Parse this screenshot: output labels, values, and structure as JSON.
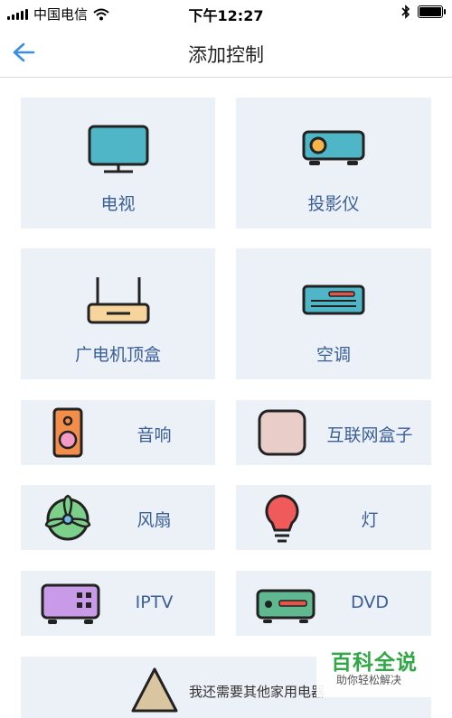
{
  "status_bar": {
    "carrier": "中国电信",
    "time": "下午12:27"
  },
  "header": {
    "title": "添加控制"
  },
  "devices": {
    "tv": "电视",
    "projector": "投影仪",
    "stb": "广电机顶盒",
    "ac": "空调",
    "speaker": "音响",
    "internet_box": "互联网盒子",
    "fan": "风扇",
    "light": "灯",
    "iptv": "IPTV",
    "dvd": "DVD",
    "other": "我还需要其他家用电器"
  },
  "watermark": {
    "main": "百科全说",
    "sub": "助你轻松解决"
  },
  "colors": {
    "card_bg": "#ecf1f8",
    "label": "#3a5f98",
    "back_arrow": "#3a8ee6",
    "watermark_green": "#2fa845"
  }
}
